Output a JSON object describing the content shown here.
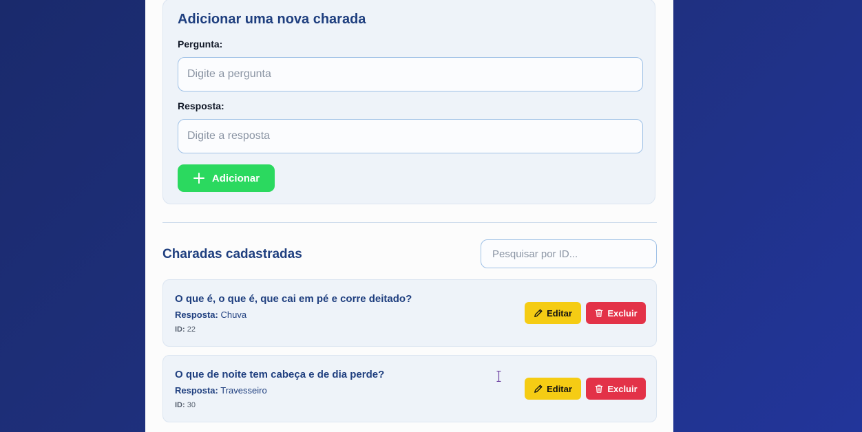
{
  "form": {
    "title": "Adicionar uma nova charada",
    "question_label": "Pergunta:",
    "question_placeholder": "Digite a pergunta",
    "answer_label": "Resposta:",
    "answer_placeholder": "Digite a resposta",
    "add_button_label": "Adicionar",
    "add_button_icon": "plus-icon"
  },
  "list": {
    "title": "Charadas cadastradas",
    "search_placeholder": "Pesquisar por ID...",
    "answer_prefix": "Resposta:",
    "id_prefix": "ID:",
    "edit_label": "Editar",
    "edit_icon": "pencil-icon",
    "delete_label": "Excluir",
    "delete_icon": "trash-icon",
    "items": [
      {
        "question": "O que é, o que é, que cai em pé e corre deitado?",
        "answer": "Chuva",
        "id": "22"
      },
      {
        "question": "O que de noite tem cabeça e de dia perde?",
        "answer": "Travesseiro",
        "id": "30"
      }
    ]
  },
  "colors": {
    "background": "#1e2f7a",
    "title": "#1f3f7f",
    "add_button": "#2bd95f",
    "edit_button": "#f5cc14",
    "delete_button": "#e33248"
  }
}
